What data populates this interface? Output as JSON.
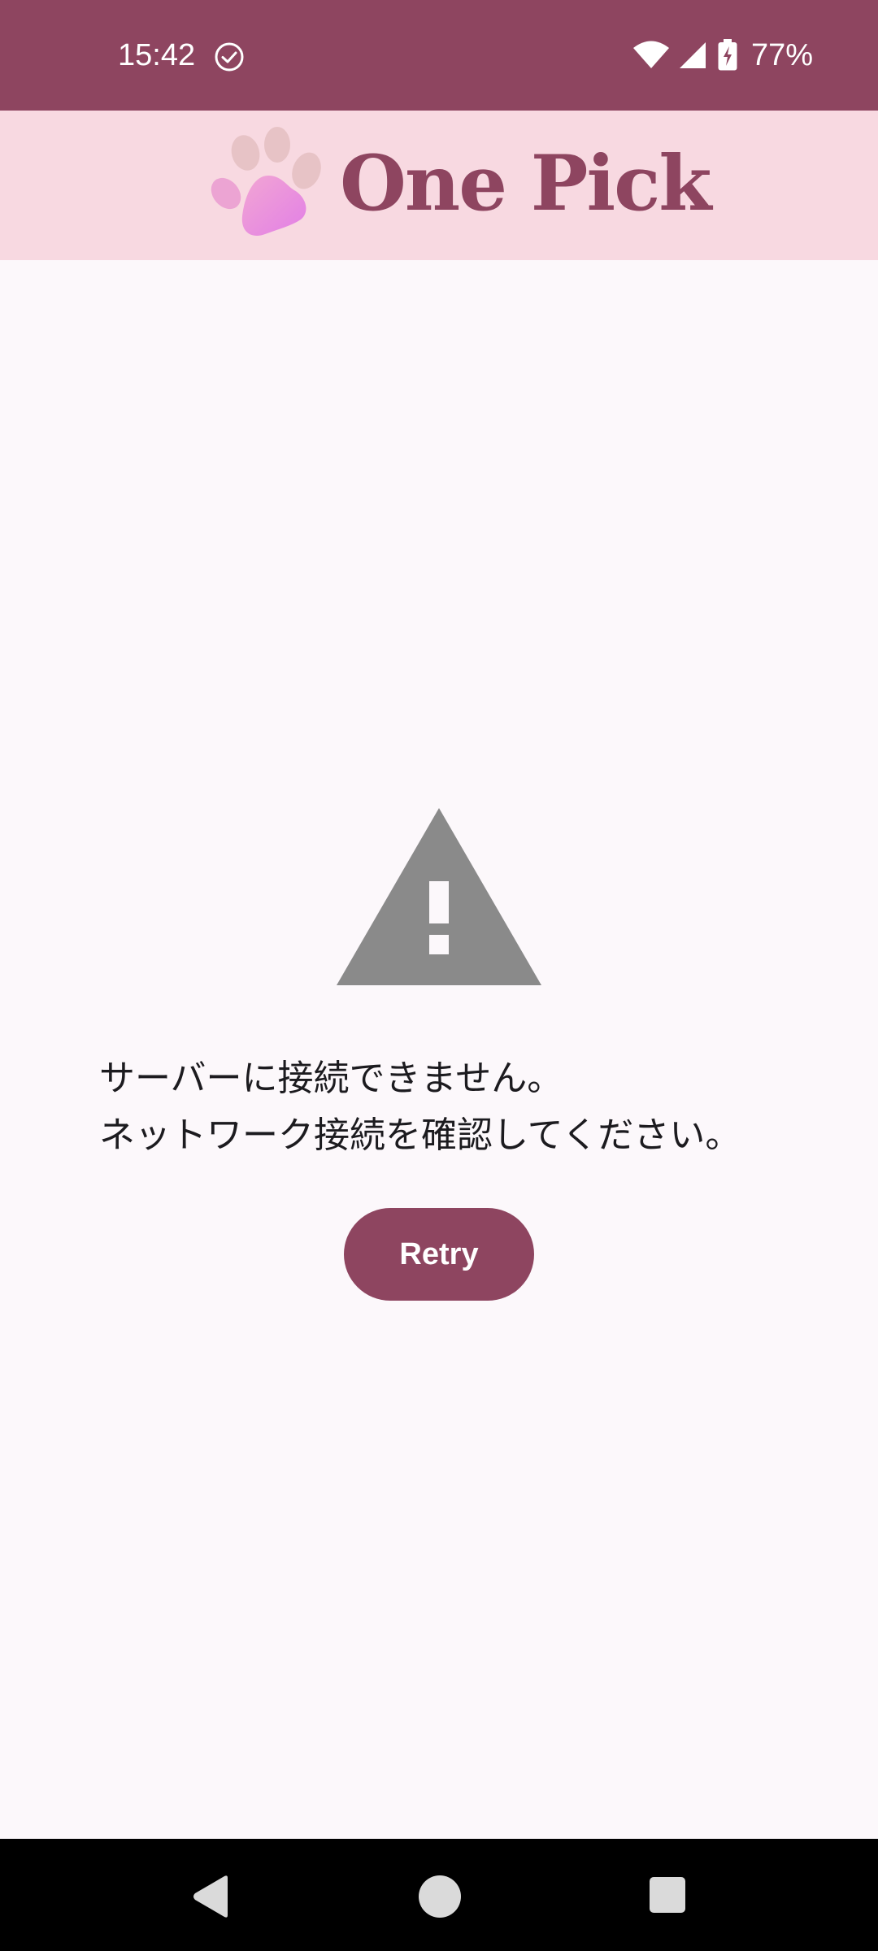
{
  "status_bar": {
    "time": "15:42",
    "battery_percent": "77%",
    "icons": [
      "check-circle-icon",
      "wifi-icon",
      "cellular-signal-icon",
      "battery-charging-icon"
    ]
  },
  "header": {
    "title": "One Pick",
    "logo": "paw-icon"
  },
  "error": {
    "icon": "warning-icon",
    "line1": "サーバーに接続できません。",
    "line2": "ネットワーク接続を確認してください。"
  },
  "retry_button": {
    "label": "Retry"
  },
  "navigation": {
    "icons": [
      "back-icon",
      "home-icon",
      "recents-icon"
    ]
  },
  "colors": {
    "primary": "#8E4560",
    "header_bg": "#F8D9E1",
    "page_bg": "#FCF8FB",
    "warning_gray": "#8A8A8A"
  }
}
